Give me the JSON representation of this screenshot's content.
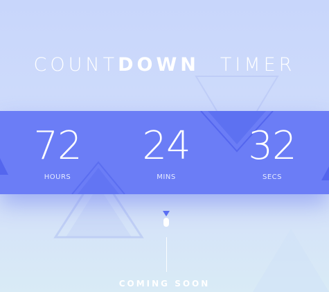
{
  "title": {
    "part1": "COUNT",
    "part2": "DOWN",
    "part3": "TIMER"
  },
  "countdown": [
    {
      "value": "72",
      "label": "HOURS"
    },
    {
      "value": "24",
      "label": "MINS"
    },
    {
      "value": "32",
      "label": "SECS"
    }
  ],
  "footer": {
    "coming_soon": "COMING SOON"
  },
  "colors": {
    "band": "#6b7df6",
    "background_top": "#c8d6fb",
    "background_bottom": "#d9ebf6",
    "accent": "#5a6ef2"
  },
  "icons": {
    "scroll": "scroll-down-icon"
  }
}
